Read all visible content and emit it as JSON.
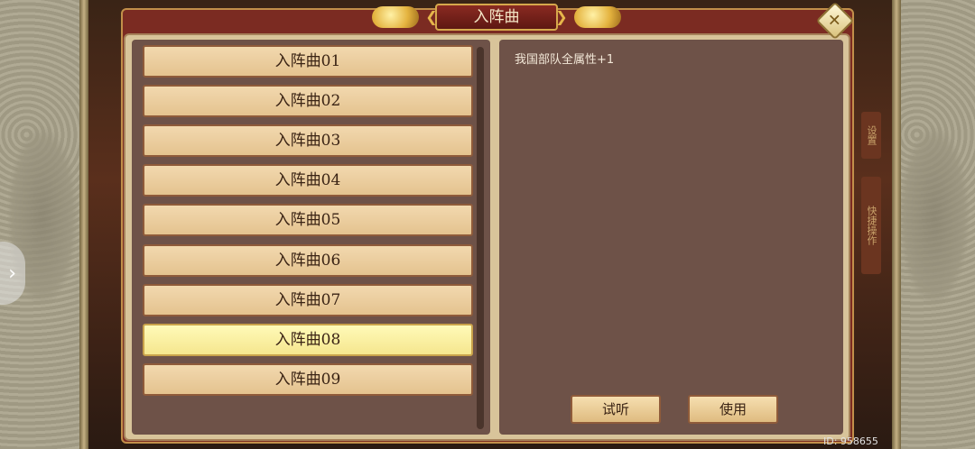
{
  "dialog": {
    "title": "入阵曲",
    "close_icon": "close-diamond-icon"
  },
  "songs": [
    {
      "label": "入阵曲01",
      "selected": false
    },
    {
      "label": "入阵曲02",
      "selected": false
    },
    {
      "label": "入阵曲03",
      "selected": false
    },
    {
      "label": "入阵曲04",
      "selected": false
    },
    {
      "label": "入阵曲05",
      "selected": false
    },
    {
      "label": "入阵曲06",
      "selected": false
    },
    {
      "label": "入阵曲07",
      "selected": false
    },
    {
      "label": "入阵曲08",
      "selected": true
    },
    {
      "label": "入阵曲09",
      "selected": false
    }
  ],
  "description": "我国部队全属性+1",
  "buttons": {
    "listen": "试听",
    "use": "使用"
  },
  "side_tabs": {
    "settings": "设置",
    "quick": "快捷操作"
  },
  "player_id": "ID: 958655",
  "colors": {
    "frame": "#7b2b22",
    "panel": "#6e5248",
    "item": "#e4c38f",
    "item_selected": "#f5e68e"
  }
}
